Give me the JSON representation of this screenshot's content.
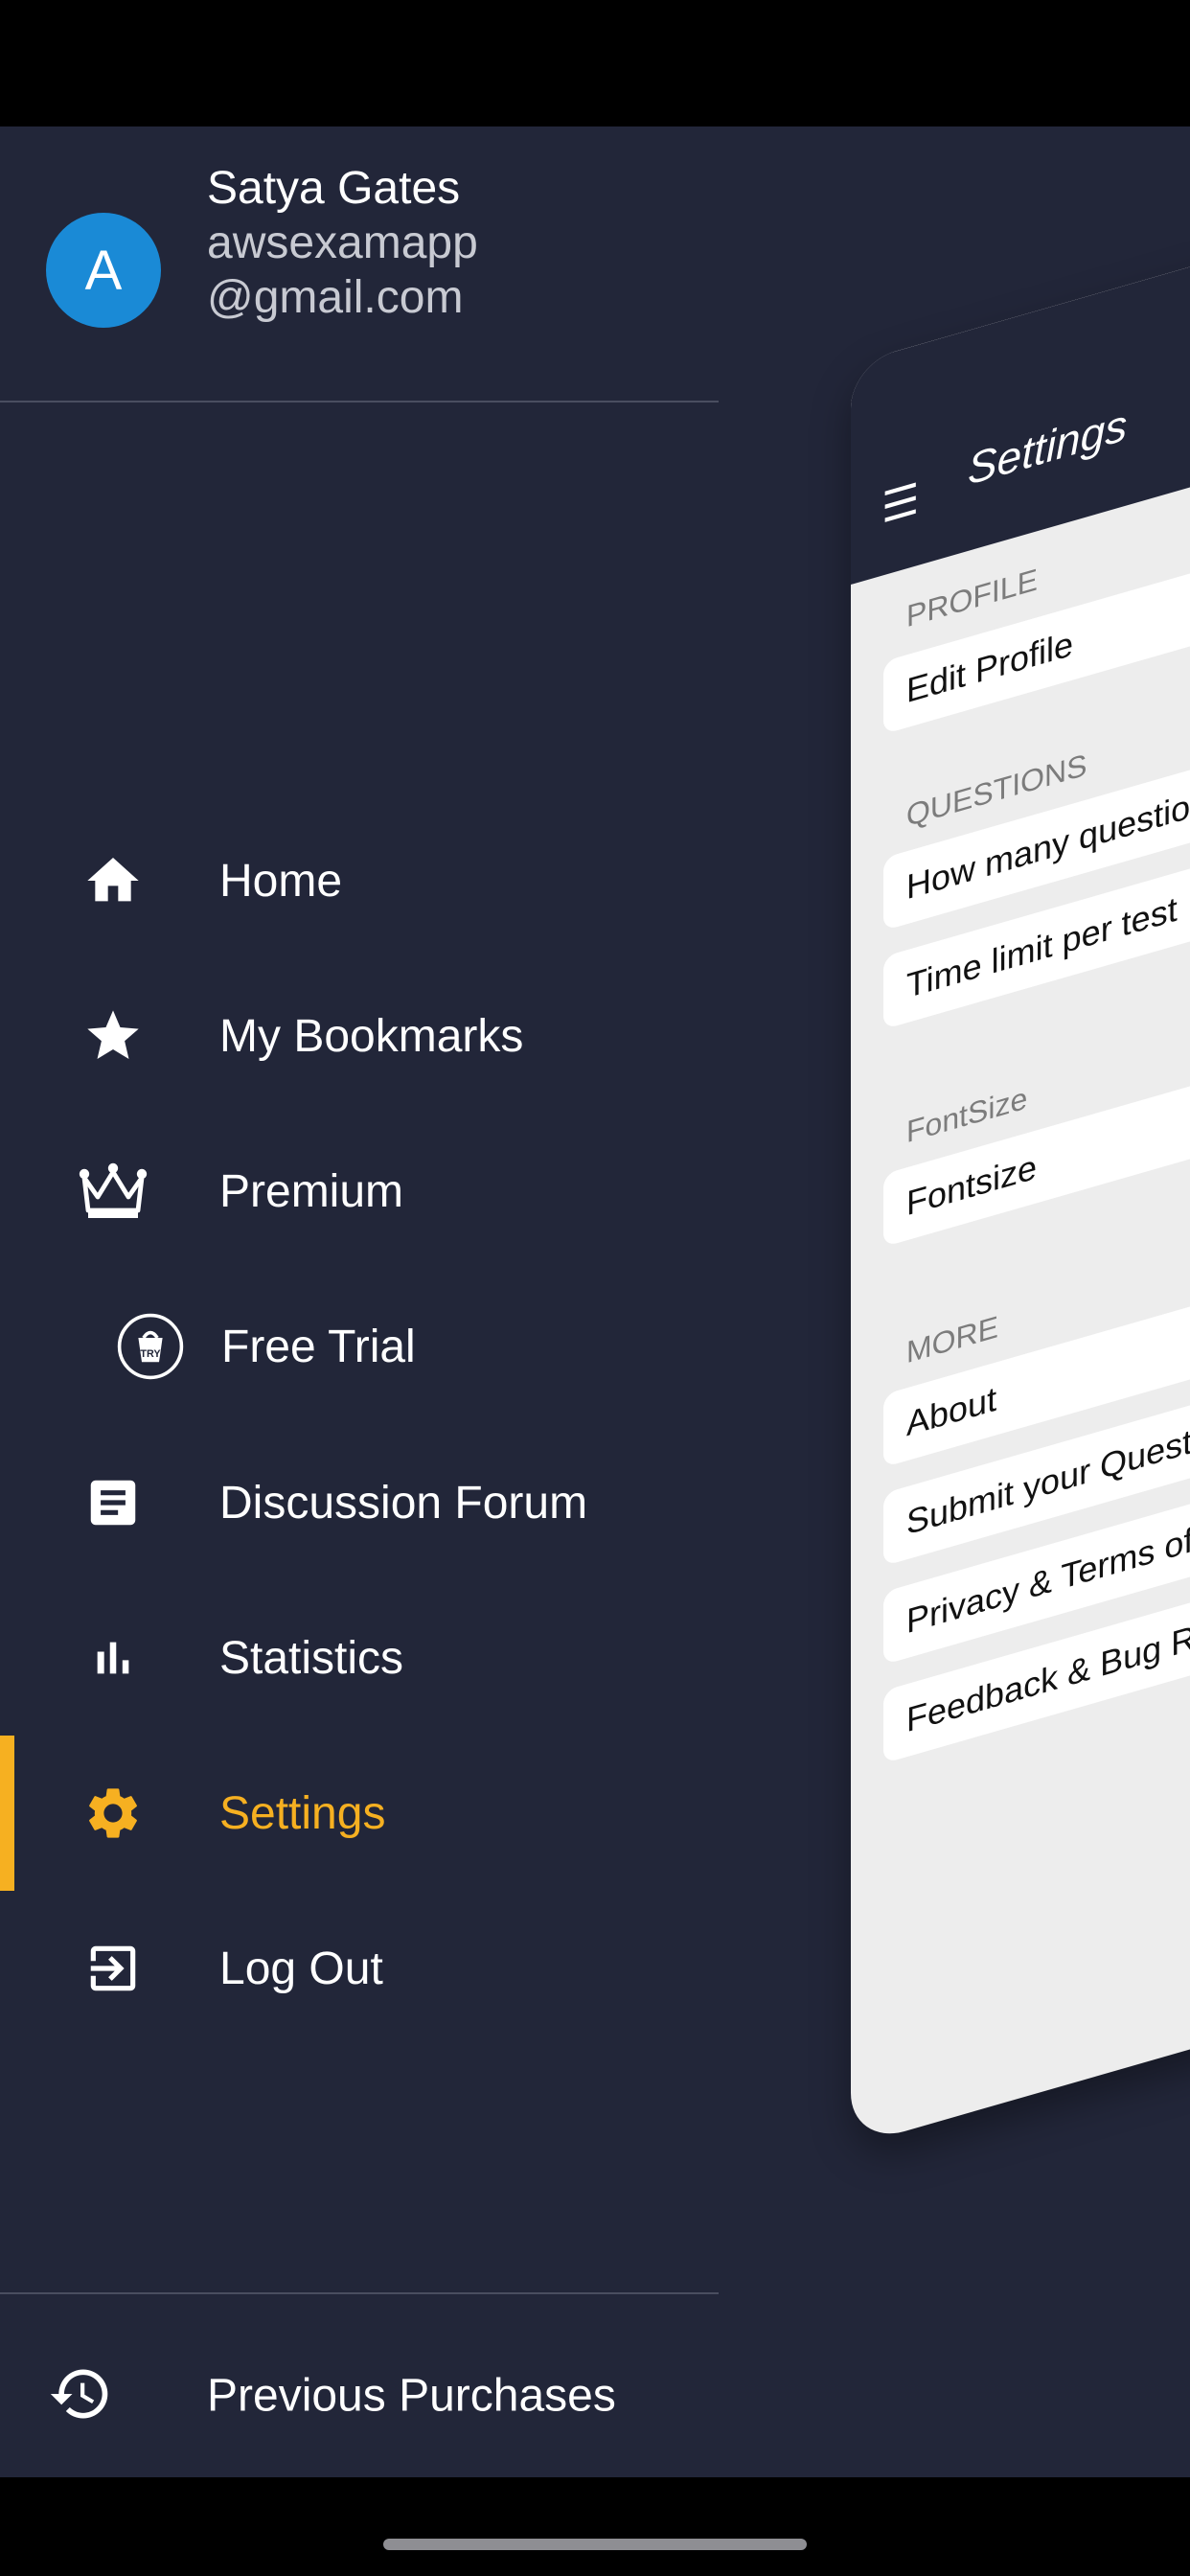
{
  "user": {
    "avatar_letter": "A",
    "name": "Satya Gates",
    "email": "awsexamapp@gmail.com"
  },
  "menu": {
    "items": [
      {
        "label": "Home",
        "icon": "home-icon"
      },
      {
        "label": "My Bookmarks",
        "icon": "star-icon"
      },
      {
        "label": "Premium",
        "icon": "crown-icon"
      },
      {
        "label": "Free Trial",
        "icon": "try-badge-icon"
      },
      {
        "label": "Discussion Forum",
        "icon": "document-icon"
      },
      {
        "label": "Statistics",
        "icon": "bar-chart-icon"
      },
      {
        "label": "Settings",
        "icon": "gear-icon",
        "active": true
      },
      {
        "label": "Log Out",
        "icon": "logout-icon"
      }
    ],
    "footer_label": "Previous Purchases",
    "footer_icon": "history-icon",
    "active_color": "#f6b021"
  },
  "preview": {
    "title": "Settings",
    "sections": {
      "profile": "PROFILE",
      "questions": "QUESTIONS",
      "fontsize": "FontSize",
      "more": "MORE"
    },
    "items": {
      "edit_profile": "Edit Profile",
      "how_many": "How many questio",
      "time_limit": "Time limit per test",
      "fontsize": "Fontsize",
      "about": "About",
      "submit": "Submit your Quest",
      "privacy": "Privacy & Terms of",
      "feedback": "Feedback & Bug R"
    }
  }
}
